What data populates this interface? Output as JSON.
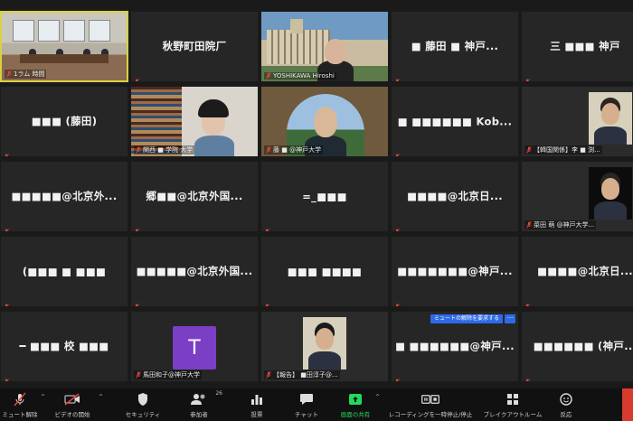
{
  "tiles": [
    {
      "name": "",
      "label": "1ラム 時間",
      "kind": "room",
      "active": true
    },
    {
      "name": "秋野町田院厂",
      "label": ""
    },
    {
      "name": "",
      "label": "YOSHIKAWA Hiroshi",
      "kind": "building"
    },
    {
      "name": "■ 藤田 ■ 神戸...",
      "label": ""
    },
    {
      "name": "三 ■■■ 神戸",
      "label": ""
    },
    {
      "name": "■■■ (藤田)",
      "label": ""
    },
    {
      "name": "",
      "label": "関西 ■ 学院 大学",
      "kind": "library"
    },
    {
      "name": "",
      "label": "藤 ■ @神戸大学",
      "kind": "arch"
    },
    {
      "name": "■ ■■■■■■ Kob...",
      "label": ""
    },
    {
      "name": "",
      "label": "【韓国関係】李 ■ 渕...",
      "kind": "portrait1"
    },
    {
      "name": "■■■■■@北京外...",
      "label": ""
    },
    {
      "name": "郷■■@北京外国...",
      "label": ""
    },
    {
      "name": "=_■■■",
      "label": ""
    },
    {
      "name": "■■■■@北京日...",
      "label": ""
    },
    {
      "name": "",
      "label": "菜田 萌 @神戸大学...",
      "kind": "portrait2"
    },
    {
      "name": "(■■■ ■ ■■■",
      "label": ""
    },
    {
      "name": "■■■■■@北京外国...",
      "label": ""
    },
    {
      "name": "■■■ ■■■■",
      "label": ""
    },
    {
      "name": "■■■■■■■@神戸...",
      "label": ""
    },
    {
      "name": "■■■■@北京日...",
      "label": ""
    },
    {
      "name": "━ ■■■ 校 ■■■",
      "label": ""
    },
    {
      "name": "",
      "label": "馬田和子@神戸大学",
      "kind": "avatar",
      "avatar_letter": "T"
    },
    {
      "name": "",
      "label": "【報告】 ■田淳子@...",
      "kind": "portrait3"
    },
    {
      "name": "■ ■■■■■■@神戸...",
      "label": ""
    },
    {
      "name": "■■■■■■ (神戸...",
      "label": ""
    }
  ],
  "tooltip": {
    "text": "ミュートの解除を要求する",
    "more": "···"
  },
  "toolbar": {
    "buttons": [
      {
        "label": "ミュート解除",
        "icon": "microphone-muted-icon"
      },
      {
        "label": "ビデオの開始",
        "icon": "video-off-icon"
      },
      {
        "label": "セキュリティ",
        "icon": "shield-icon"
      },
      {
        "label": "参加者",
        "icon": "participants-icon",
        "count": "26"
      },
      {
        "label": "投票",
        "icon": "poll-icon"
      },
      {
        "label": "チャット",
        "icon": "chat-icon"
      },
      {
        "label": "画面の共有",
        "icon": "share-screen-icon"
      },
      {
        "label": "レコーディングを一時停止/停止",
        "icon": "recording-icon"
      },
      {
        "label": "ブレイクアウトルーム",
        "icon": "breakout-rooms-icon"
      },
      {
        "label": "反応",
        "icon": "reaction-icon"
      }
    ]
  },
  "colors": {
    "active_border": "#d8d240",
    "share_green": "#23d959",
    "mute_red": "#e8443a",
    "tooltip_blue": "#2d6be8",
    "avatar_purple": "#7a3fc5"
  }
}
